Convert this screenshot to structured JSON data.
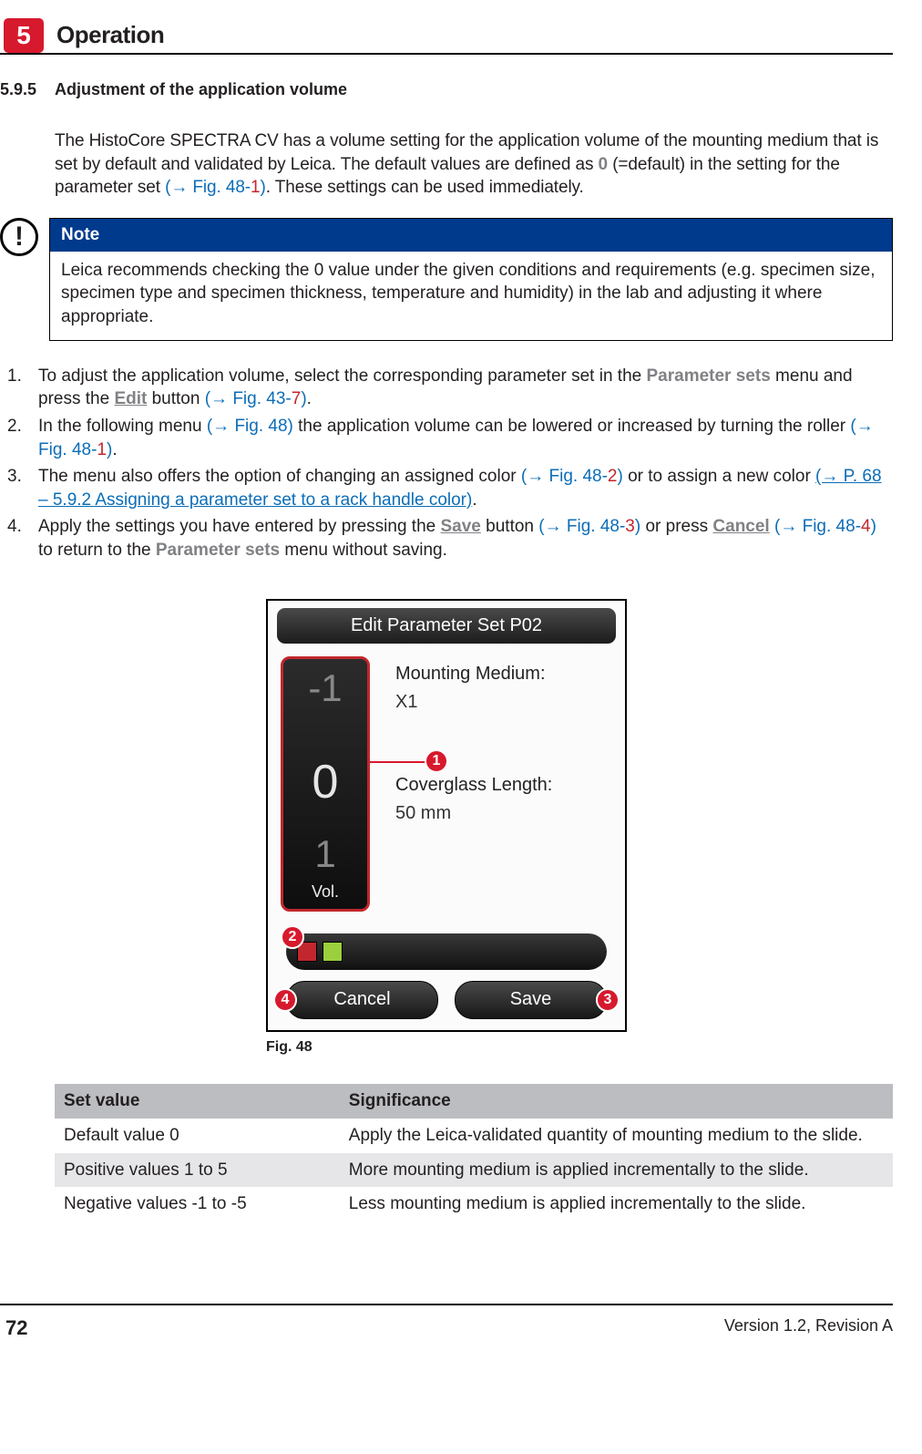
{
  "header": {
    "chapter_number": "5",
    "chapter_title": "Operation"
  },
  "section": {
    "number": "5.9.5",
    "title": "Adjustment of the application volume"
  },
  "intro": {
    "t1": "The HistoCore SPECTRA CV has a volume setting for the application volume of the mounting medium that is set by default and validated by Leica. The default values are defined as ",
    "zero": "0",
    "t2": " (=default) in the setting for the parameter set ",
    "ref1a": "(→ Fig.  48‑",
    "ref1n": "1",
    "ref1b": ")",
    "t3": ". These settings can be used immediately."
  },
  "note": {
    "title": "Note",
    "body": "Leica recommends checking the 0 value under the given conditions and requirements (e.g. specimen size, specimen type and specimen thickness, temperature and humidity) in the lab and adjusting it where appropriate."
  },
  "steps": {
    "s1a": "To adjust the application volume, select the corresponding parameter set in the ",
    "s1b": "Parameter sets",
    "s1c": " menu and press the ",
    "s1d": "Edit",
    "s1e": " button ",
    "s1f": "(→ Fig.  43‑",
    "s1g": "7",
    "s1h": ")",
    "s1i": ".",
    "s2a": "In the following menu ",
    "s2b": "(→ Fig.  48)",
    "s2c": " the application volume can be lowered or increased by turning the roller ",
    "s2d": "(→ Fig.  48‑",
    "s2e": "1",
    "s2f": ")",
    "s2g": ".",
    "s3a": "The menu also offers the option of changing an assigned color ",
    "s3b": "(→ Fig.  48‑",
    "s3c": "2",
    "s3d": ")",
    "s3e": " or to assign a new color ",
    "s3f": "(→ P. 68 – 5.9.2 Assigning a parameter set to a rack handle color)",
    "s3g": ".",
    "s4a": "Apply the settings you have entered by pressing the ",
    "s4b": "Save",
    "s4c": " button ",
    "s4d": "(→ Fig.  48‑",
    "s4e": "3",
    "s4f": ")",
    "s4g": " or press ",
    "s4h": "Cancel",
    "s4i": " ",
    "s4j": "(→ Fig.  48‑",
    "s4k": "4",
    "s4l": ")",
    "s4m": " to return to the ",
    "s4n": "Parameter sets",
    "s4o": " menu without saving."
  },
  "figure": {
    "title": "Edit Parameter Set P02",
    "roller_top": "-1",
    "roller_mid": "0",
    "roller_bot": "1",
    "roller_label": "Vol.",
    "mm_label": "Mounting Medium:",
    "mm_value": "X1",
    "cg_label": "Coverglass Length:",
    "cg_value": "50 mm",
    "cancel": "Cancel",
    "save": "Save",
    "caption": "Fig.  48",
    "c1": "1",
    "c2": "2",
    "c3": "3",
    "c4": "4"
  },
  "table": {
    "h1": "Set value",
    "h2": "Significance",
    "r1a": "Default value 0",
    "r1b": "Apply the Leica-validated quantity of mounting medium to the slide.",
    "r2a": "Positive values 1 to 5",
    "r2b": "More mounting medium is applied incrementally to the slide.",
    "r3a": "Negative values -1 to -5",
    "r3b": "Less mounting medium is applied incrementally to the slide."
  },
  "footer": {
    "page": "72",
    "version": "Version 1.2, Revision A"
  }
}
